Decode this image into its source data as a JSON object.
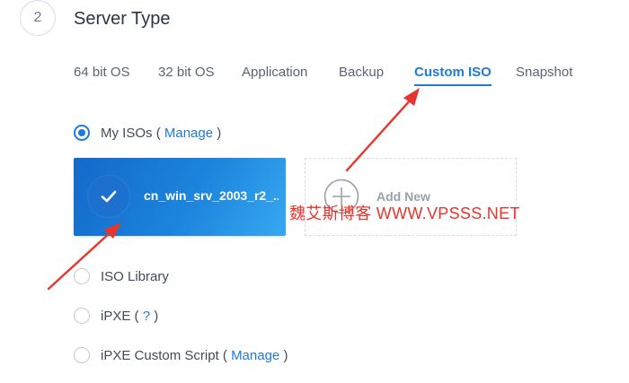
{
  "step": {
    "number": "2",
    "title": "Server Type"
  },
  "tabs": [
    {
      "label": "64 bit OS",
      "active": false
    },
    {
      "label": "32 bit OS",
      "active": false
    },
    {
      "label": "Application",
      "active": false
    },
    {
      "label": "Backup",
      "active": false
    },
    {
      "label": "Custom ISO",
      "active": true
    },
    {
      "label": "Snapshot",
      "active": false
    }
  ],
  "options": {
    "my_isos": {
      "label": "My ISOs",
      "paren_open": "(",
      "link": "Manage",
      "paren_close": ")",
      "checked": true
    },
    "iso_library": {
      "label": "ISO Library",
      "checked": false
    },
    "ipxe": {
      "label": "iPXE",
      "paren_open": "(",
      "link": "?",
      "paren_close": ")",
      "checked": false
    },
    "ipxe_custom": {
      "label": "iPXE Custom Script",
      "paren_open": "(",
      "link": "Manage",
      "paren_close": ")",
      "checked": false
    }
  },
  "iso_card": {
    "name": "cn_win_srv_2003_r2_...",
    "selected": true,
    "icon": "checkmark-icon"
  },
  "add_card": {
    "label": "Add New",
    "icon": "plus-circle-icon"
  },
  "watermark": "魏艾斯博客 WWW.VPSSS.NET",
  "colors": {
    "accent": "#1e7bd8",
    "annotation": "#e8342b",
    "card_gradient_start": "#1369c9",
    "card_gradient_end": "#37a8f0"
  }
}
